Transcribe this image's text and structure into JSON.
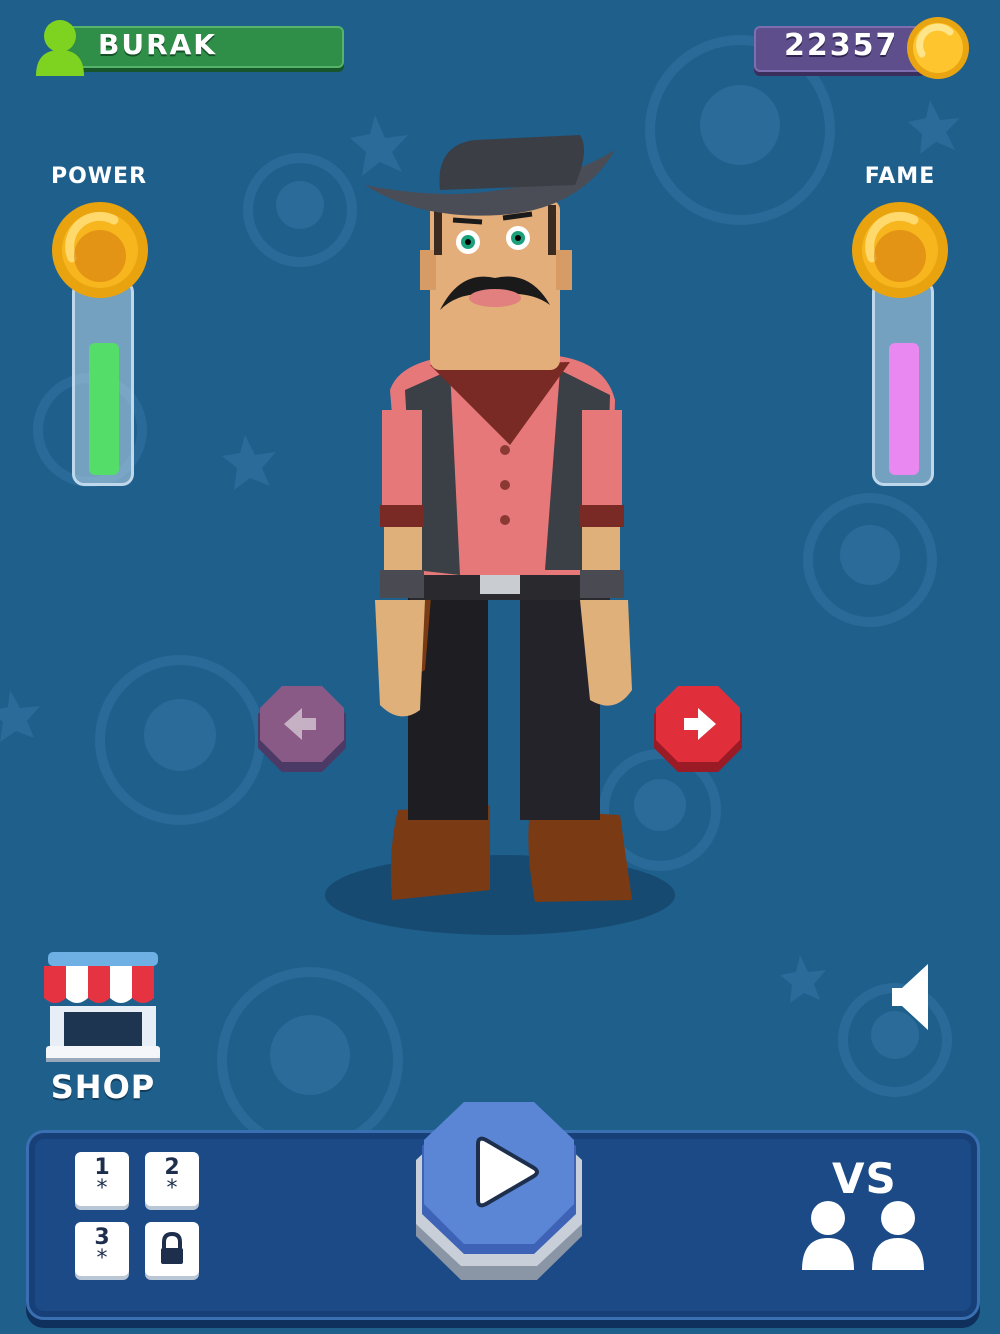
{
  "header": {
    "player_name": "BURAK",
    "coins": "22357",
    "icons": [
      "player-avatar-icon",
      "coin-icon"
    ]
  },
  "meters": {
    "power": {
      "label": "POWER",
      "level": 0.72,
      "color": "#55dd6a"
    },
    "fame": {
      "label": "FAME",
      "level": 0.72,
      "color": "#e888f0"
    }
  },
  "character": {
    "name": "cowboy"
  },
  "navigation": {
    "prev_icon": "arrow-left-icon",
    "next_icon": "arrow-right-icon"
  },
  "shop": {
    "label": "SHOP",
    "icon": "shop-storefront-icon"
  },
  "sound": {
    "icon": "speaker-icon"
  },
  "modes": [
    {
      "number": "1",
      "star": "*",
      "locked": false
    },
    {
      "number": "2",
      "star": "*",
      "locked": false
    },
    {
      "number": "3",
      "star": "*",
      "locked": false
    },
    {
      "number": "",
      "star": "",
      "locked": true,
      "icon": "lock-icon"
    }
  ],
  "play": {
    "icon": "play-icon"
  },
  "versus": {
    "label": "VS",
    "icon": "two-players-icon"
  },
  "colors": {
    "background": "#1e5f8c",
    "player_bar": "#2f8f48",
    "coin_bar": "#5e4e8c",
    "panel": "#1c4a86",
    "play_button": "#5b86d6",
    "next_button": "#e02f3a",
    "prev_button": "#8a5a86"
  }
}
